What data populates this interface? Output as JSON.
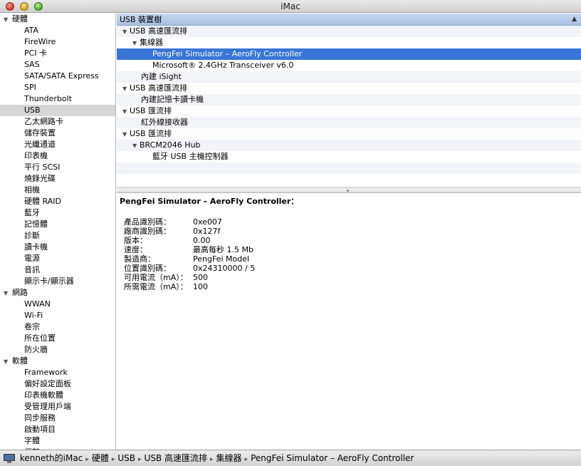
{
  "window": {
    "title": "iMac"
  },
  "sidebar": {
    "groups": [
      {
        "label": "硬體",
        "items": [
          "ATA",
          "FireWire",
          "PCI 卡",
          "SAS",
          "SATA/SATA Express",
          "SPI",
          "Thunderbolt",
          "USB",
          "乙太網路卡",
          "儲存裝置",
          "光纖通道",
          "印表機",
          "平行 SCSI",
          "燒錄光碟",
          "相機",
          "硬體 RAID",
          "藍牙",
          "記憶體",
          "診斷",
          "讀卡機",
          "電源",
          "音訊",
          "顯示卡/顯示器"
        ]
      },
      {
        "label": "網路",
        "items": [
          "WWAN",
          "Wi-Fi",
          "卷宗",
          "所在位置",
          "防火牆"
        ]
      },
      {
        "label": "軟體",
        "items": [
          "Framework",
          "偏好設定面板",
          "印表機軟體",
          "受管理用戶端",
          "同步服務",
          "啟動項目",
          "字體",
          "框架"
        ]
      }
    ],
    "selected": "USB"
  },
  "tree": {
    "header": "USB 裝置樹",
    "rows": [
      {
        "label": "USB 高速匯流排",
        "level": "lvl0",
        "expand": "▼"
      },
      {
        "label": "集線器",
        "level": "lvl1",
        "expand": "▼"
      },
      {
        "label": "PengFei Simulator – AeroFly Controller",
        "level": "lvl2",
        "expand": "",
        "selected": true
      },
      {
        "label": "Microsoft® 2.4GHz Transceiver v6.0",
        "level": "lvl2",
        "expand": ""
      },
      {
        "label": "內建 iSight",
        "level": "lvl1-leaf",
        "expand": ""
      },
      {
        "label": "USB 高速匯流排",
        "level": "lvl0",
        "expand": "▼"
      },
      {
        "label": "內建記憶卡讀卡機",
        "level": "lvl1-leaf",
        "expand": ""
      },
      {
        "label": "USB 匯流排",
        "level": "lvl0",
        "expand": "▼"
      },
      {
        "label": "紅外線接收器",
        "level": "lvl1-leaf",
        "expand": ""
      },
      {
        "label": "USB 匯流排",
        "level": "lvl0",
        "expand": "▼"
      },
      {
        "label": "BRCM2046 Hub",
        "level": "lvl1",
        "expand": "▼"
      },
      {
        "label": "藍牙 USB 主機控制器",
        "level": "lvl2",
        "expand": ""
      },
      {
        "label": "",
        "level": "lvl0",
        "expand": ""
      },
      {
        "label": "",
        "level": "lvl0",
        "expand": ""
      },
      {
        "label": "",
        "level": "lvl0",
        "expand": ""
      }
    ]
  },
  "detail": {
    "title": "PengFei Simulator – AeroFly Controller：",
    "properties": [
      {
        "key": "產品識別碼：",
        "value": "0xe007"
      },
      {
        "key": "廠商識別碼：",
        "value": "0x127f"
      },
      {
        "key": "版本：",
        "value": " 0.00"
      },
      {
        "key": "速度：",
        "value": "最高每秒 1.5 Mb"
      },
      {
        "key": "製造商：",
        "value": "PengFei Model"
      },
      {
        "key": "位置識別碼：",
        "value": "0x24310000 / 5"
      },
      {
        "key": "可用電流（mA）：",
        "value": "500"
      },
      {
        "key": "所需電流（mA）：",
        "value": "100"
      }
    ]
  },
  "pathbar": {
    "items": [
      "kenneth的iMac",
      "硬體",
      "USB",
      "USB 高速匯流排",
      "集線器",
      "PengFei Simulator – AeroFly Controller"
    ],
    "separator": "▸"
  },
  "colors": {
    "selection": "#3875d7",
    "header": "#b8cbe7",
    "sidebar_selection": "#d6d6d6"
  },
  "icons": {
    "titlebar": [
      "close-icon",
      "minimize-icon",
      "zoom-icon"
    ],
    "pathbar": "computer-icon"
  }
}
